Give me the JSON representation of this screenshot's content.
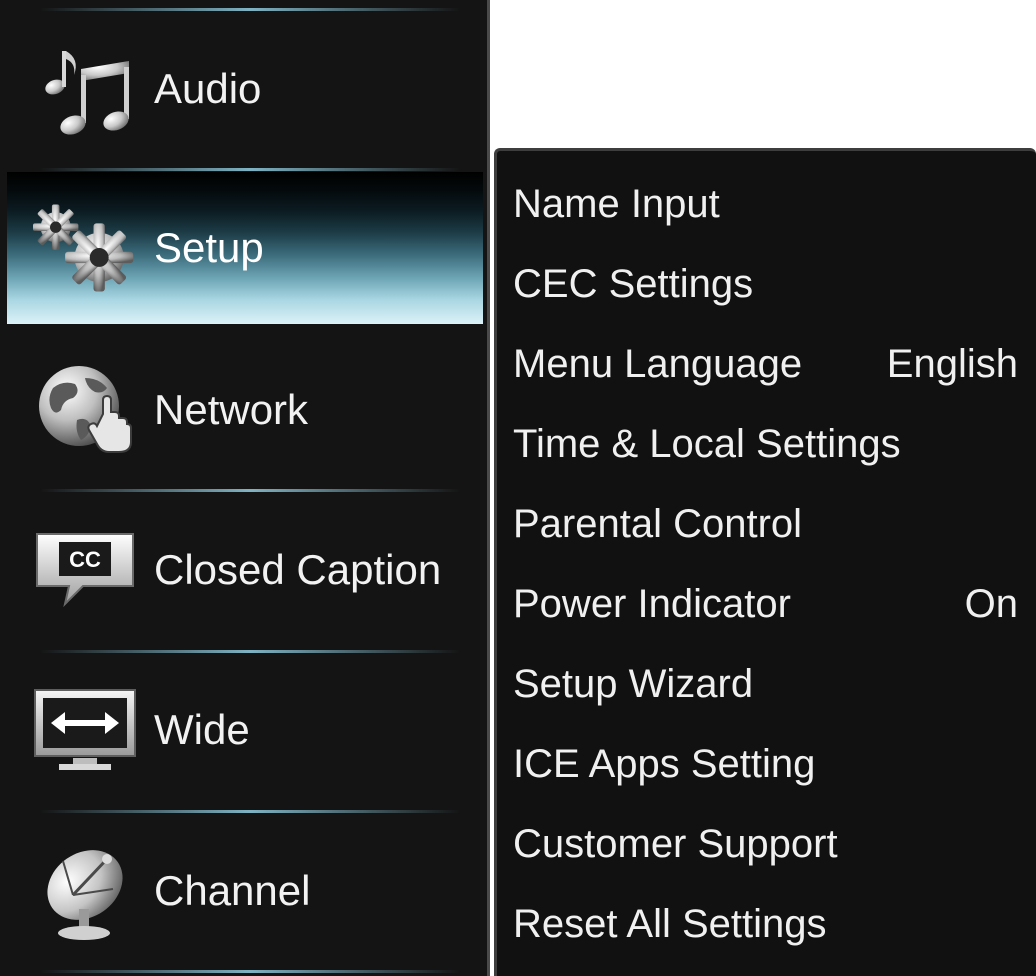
{
  "main_menu": {
    "items": [
      {
        "label": "Audio",
        "icon": "music-note-icon"
      },
      {
        "label": "Setup",
        "icon": "gears-icon",
        "selected": true
      },
      {
        "label": "Network",
        "icon": "globe-hand-icon"
      },
      {
        "label": "Closed Caption",
        "icon": "cc-icon"
      },
      {
        "label": "Wide",
        "icon": "wide-screen-icon"
      },
      {
        "label": "Channel",
        "icon": "satellite-dish-icon"
      }
    ]
  },
  "sub_menu": {
    "items": [
      {
        "label": "Name Input",
        "value": ""
      },
      {
        "label": "CEC Settings",
        "value": ""
      },
      {
        "label": "Menu Language",
        "value": "English"
      },
      {
        "label": "Time & Local Settings",
        "value": ""
      },
      {
        "label": "Parental Control",
        "value": ""
      },
      {
        "label": "Power Indicator",
        "value": "On"
      },
      {
        "label": "Setup Wizard",
        "value": ""
      },
      {
        "label": "ICE Apps Setting",
        "value": ""
      },
      {
        "label": "Customer Support",
        "value": ""
      },
      {
        "label": "Reset All Settings",
        "value": ""
      }
    ]
  },
  "colors": {
    "menu_bg": "#141414",
    "highlight_top": "#000000",
    "highlight_bottom": "#ddf2f8",
    "text": "#f0f0f0"
  }
}
